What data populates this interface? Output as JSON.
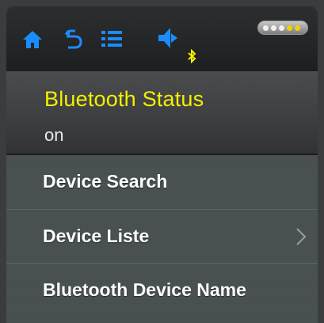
{
  "topbar": {
    "icons": [
      "home-icon",
      "back-icon",
      "menu-icon",
      "speaker-icon",
      "bluetooth-icon"
    ],
    "accent_color": "#1a8cff",
    "bluetooth_color": "#f3f000",
    "battery_level": 0.6
  },
  "status": {
    "title": "Bluetooth Status",
    "value": "on"
  },
  "list": {
    "items": [
      {
        "label": "Device Search",
        "has_chevron": false
      },
      {
        "label": "Device Liste",
        "has_chevron": true
      },
      {
        "label": "Bluetooth Device Name",
        "has_chevron": false
      }
    ]
  }
}
